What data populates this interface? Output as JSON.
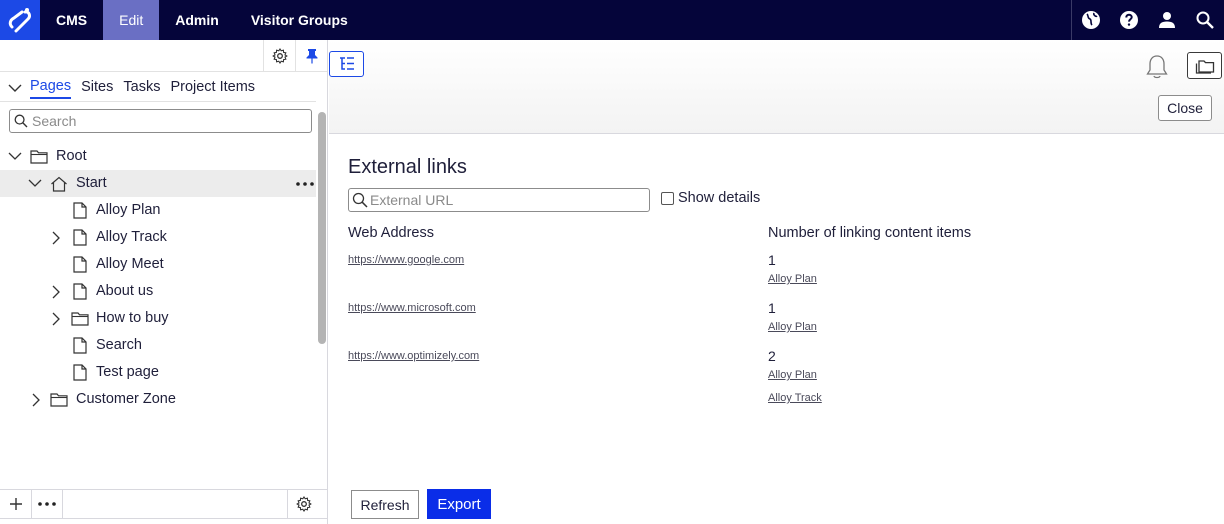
{
  "topbar": {
    "logo": "optimizely-logo",
    "nav": [
      {
        "label": "CMS"
      },
      {
        "label": "Edit"
      },
      {
        "label": "Admin"
      },
      {
        "label": "Visitor Groups"
      }
    ],
    "active": "Edit",
    "icons": [
      "globe-icon",
      "help-icon",
      "user-icon",
      "search-icon"
    ]
  },
  "left_panel": {
    "tabs": [
      "Pages",
      "Sites",
      "Tasks",
      "Project Items"
    ],
    "active_tab": "Pages",
    "search_placeholder": "Search",
    "tree": {
      "root": "Root",
      "start": "Start",
      "children": [
        "Alloy Plan",
        "Alloy Track",
        "Alloy Meet",
        "About us",
        "How to buy",
        "Search",
        "Test page"
      ],
      "customer_zone": "Customer Zone"
    }
  },
  "main": {
    "close_label": "Close",
    "heading": "External links",
    "url_placeholder": "External URL",
    "show_details_label": "Show details",
    "col_address": "Web Address",
    "col_count": "Number of linking content items",
    "rows": [
      {
        "url": "https://www.google.com",
        "count": "1",
        "items": [
          "Alloy Plan"
        ]
      },
      {
        "url": "https://www.microsoft.com",
        "count": "1",
        "items": [
          "Alloy Plan"
        ]
      },
      {
        "url": "https://www.optimizely.com",
        "count": "2",
        "items": [
          "Alloy Plan",
          "Alloy Track"
        ]
      }
    ],
    "refresh_label": "Refresh",
    "export_label": "Export"
  },
  "colors": {
    "topbar": "#05053a",
    "accent": "#1c49e6",
    "active_nav": "#6a6fc4",
    "export": "#0a2de8"
  }
}
